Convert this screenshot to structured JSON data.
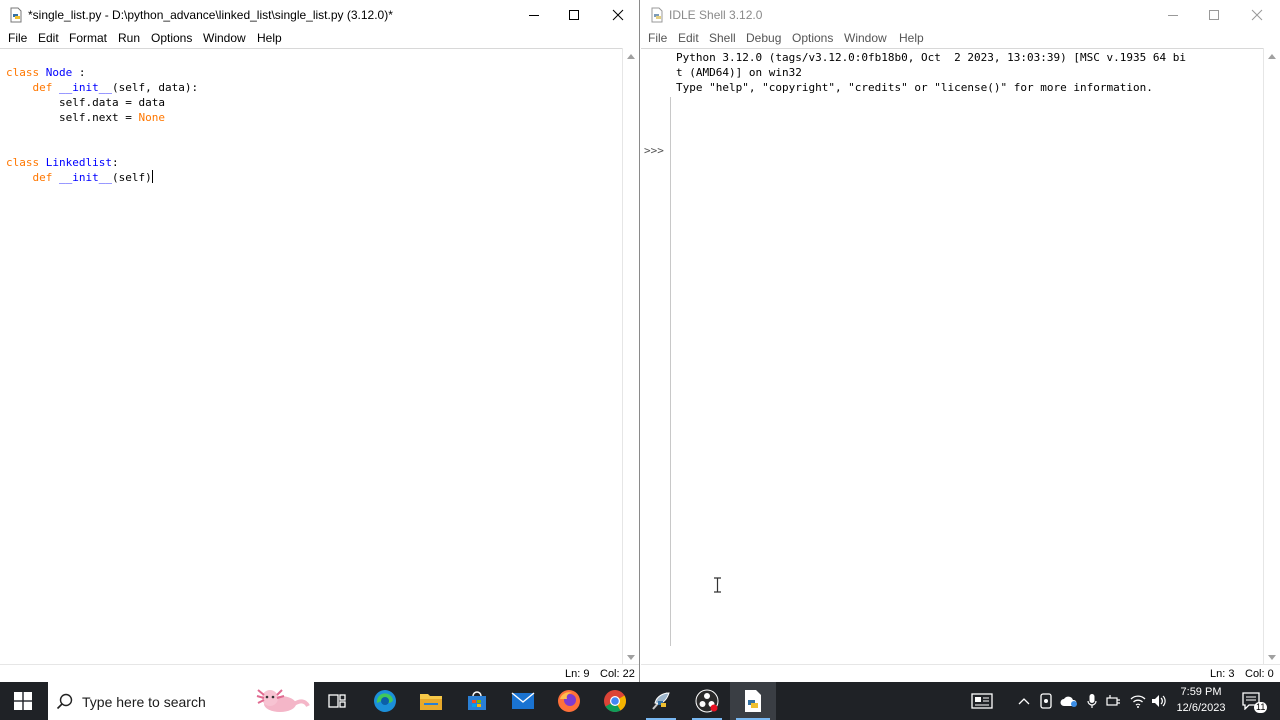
{
  "editor": {
    "title": "*single_list.py - D:\\python_advance\\linked_list\\single_list.py (3.12.0)*",
    "menu": [
      "File",
      "Edit",
      "Format",
      "Run",
      "Options",
      "Window",
      "Help"
    ],
    "code": {
      "l1_kw": "class",
      "l1_name": "Node",
      "l1_rest": " :",
      "l2_ind": "    ",
      "l2_kw": "def",
      "l2_sp": " ",
      "l2_name": "__init__",
      "l2_rest": "(self, data):",
      "l3": "        self.data = data",
      "l4_pre": "        self.next = ",
      "l4_kw": "None",
      "l7_kw": "class",
      "l7_name": "Linkedlist",
      "l7_rest": ":",
      "l8_ind": "    ",
      "l8_kw": "def",
      "l8_sp": " ",
      "l8_name": "__init__",
      "l8_rest": "(self)"
    },
    "status": {
      "ln": "Ln: 9",
      "col": "Col: 22"
    }
  },
  "shell": {
    "title": "IDLE Shell 3.12.0",
    "menu": [
      "File",
      "Edit",
      "Shell",
      "Debug",
      "Options",
      "Window",
      "Help"
    ],
    "output": [
      "Python 3.12.0 (tags/v3.12.0:0fb18b0, Oct  2 2023, 13:03:39) [MSC v.1935 64 bi",
      "t (AMD64)] on win32",
      "Type \"help\", \"copyright\", \"credits\" or \"license()\" for more information."
    ],
    "prompt": ">>>",
    "status": {
      "ln": "Ln: 3",
      "col": "Col: 0"
    }
  },
  "taskbar": {
    "search_placeholder": "Type here to search",
    "time": "7:59 PM",
    "date": "12/6/2023",
    "notification_count": "11",
    "apps": [
      "task-view",
      "edge",
      "file-explorer",
      "microsoft-store",
      "mail",
      "firefox",
      "chrome",
      "idle-python",
      "obs",
      "idle-editor"
    ]
  },
  "colors": {
    "keyword": "#ff7700",
    "definition": "#0000ff",
    "builtin": "#900090",
    "taskbar_bg": "#1f2226"
  }
}
